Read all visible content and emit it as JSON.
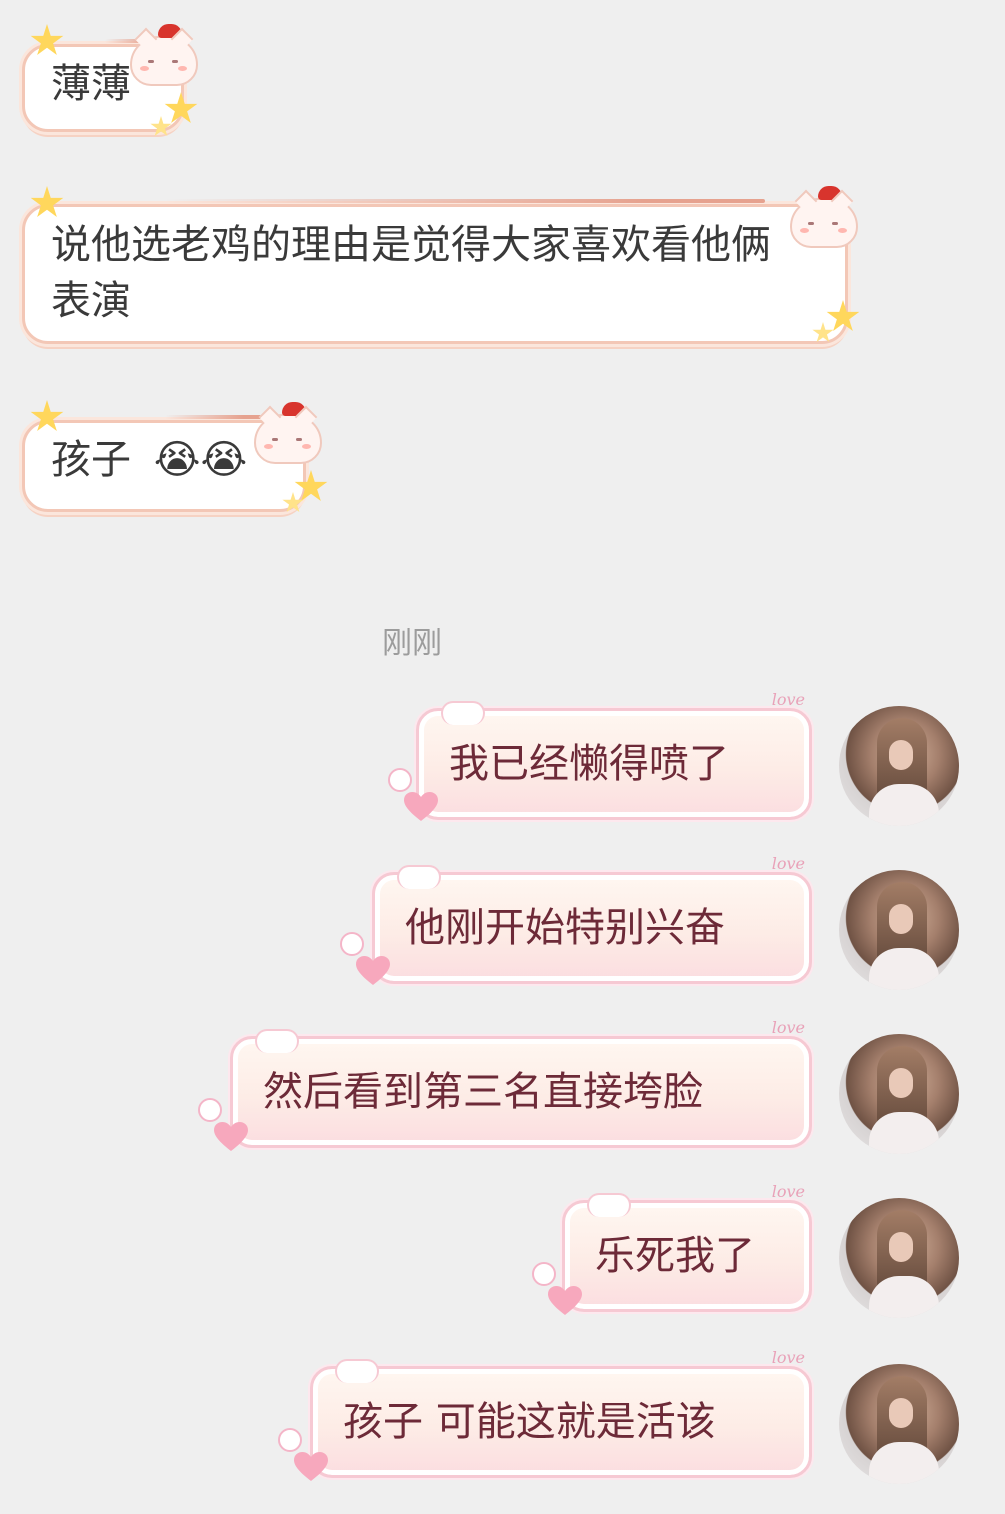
{
  "colors": {
    "background": "#efefef",
    "left_bubble_border": "#f3c7b6",
    "right_bubble_text": "#6d2a38",
    "timestamp": "#9c9c9c"
  },
  "incoming_messages": [
    {
      "text": "薄薄",
      "emoji": ""
    },
    {
      "text": "说他选老鸡的理由是觉得大家喜欢看他俩表演",
      "emoji": ""
    },
    {
      "text": "孩子",
      "emoji": "😭😭"
    }
  ],
  "timestamp": "刚刚",
  "outgoing_messages": [
    {
      "text": "我已经懒得喷了"
    },
    {
      "text": "他刚开始特别兴奋"
    },
    {
      "text": "然后看到第三名直接垮脸"
    },
    {
      "text": "乐死我了"
    },
    {
      "text": "孩子 可能这就是活该"
    }
  ],
  "bubble_decoration_text": "love",
  "icons": {
    "incoming_bubble": [
      "star-icon",
      "cat-icon"
    ],
    "outgoing_bubble": [
      "heart-icon",
      "speech-bubble-icon"
    ],
    "avatar": "user-avatar"
  }
}
